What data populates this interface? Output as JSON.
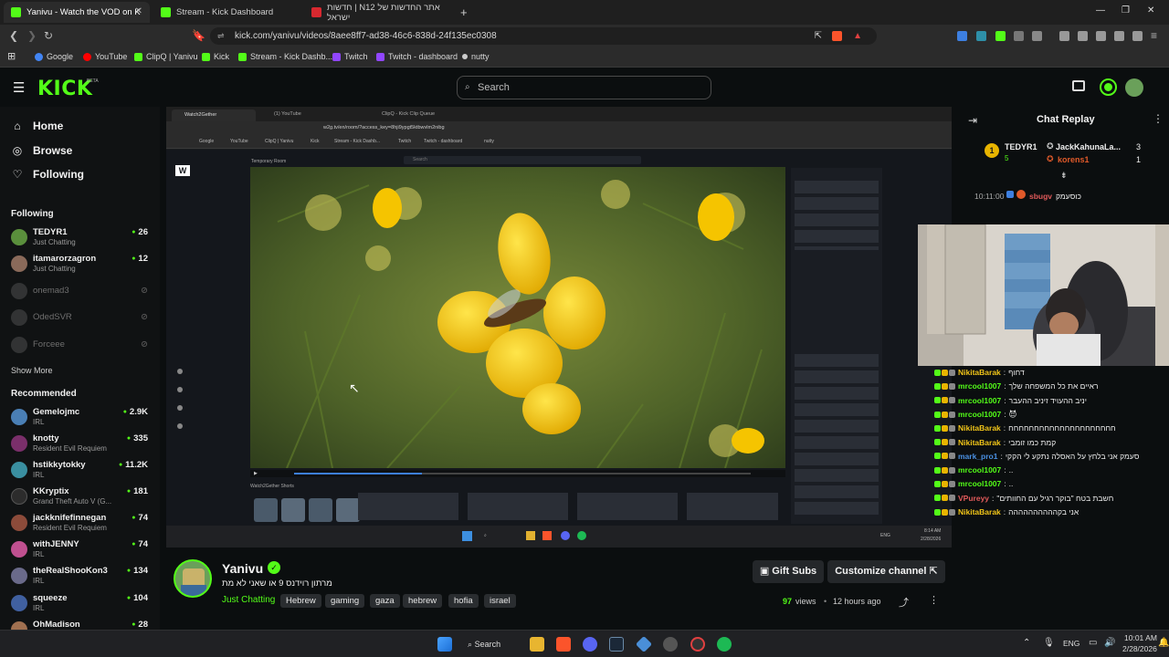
{
  "browser": {
    "tabs": [
      {
        "label": "Yanivu - Watch the VOD on K",
        "favicon_color": "#53fc18",
        "active": true
      },
      {
        "label": "Stream - Kick Dashboard",
        "favicon_color": "#53fc18",
        "active": false
      },
      {
        "label": "חדשות | N12 אתר החדשות של ישראל",
        "favicon_color": "#d7282f",
        "active": false
      }
    ],
    "new_tab": "+",
    "url": "kick.com/yanivu/videos/8aee8ff7-ad38-46c6-838d-24f135ec0308",
    "bookmarks": [
      {
        "label": "Google",
        "color": "#4285f4"
      },
      {
        "label": "YouTube",
        "color": "#ff0000"
      },
      {
        "label": "ClipQ | Yanivu",
        "color": "#53fc18"
      },
      {
        "label": "Kick",
        "color": "#53fc18"
      },
      {
        "label": "Stream - Kick Dashb...",
        "color": "#53fc18"
      },
      {
        "label": "Twitch",
        "color": "#9146ff"
      },
      {
        "label": "Twitch - dashboard",
        "color": "#9146ff"
      },
      {
        "label": "nutty",
        "color": "#cccccc"
      }
    ]
  },
  "kick": {
    "logo": "KICK",
    "logo_badge": "BETA",
    "search_placeholder": "Search",
    "accent": "#53fc18"
  },
  "sidebar": {
    "nav": [
      {
        "label": "Home",
        "icon": "home-icon"
      },
      {
        "label": "Browse",
        "icon": "compass-icon"
      },
      {
        "label": "Following",
        "icon": "heart-icon"
      }
    ],
    "following_title": "Following",
    "following": [
      {
        "name": "TEDYR1",
        "category": "Just Chatting",
        "viewers": "26",
        "live": true,
        "color": "#5a8f3c"
      },
      {
        "name": "itamarorzagron",
        "category": "Just Chatting",
        "viewers": "12",
        "live": true,
        "color": "#8a6a5a"
      },
      {
        "name": "onemad3",
        "category": "",
        "viewers": "",
        "live": false,
        "color": "#555555"
      },
      {
        "name": "OdedSVR",
        "category": "",
        "viewers": "",
        "live": false,
        "color": "#555555"
      },
      {
        "name": "Forceee",
        "category": "",
        "viewers": "",
        "live": false,
        "color": "#555555"
      }
    ],
    "show_more": "Show More",
    "recommended_title": "Recommended",
    "recommended": [
      {
        "name": "Gemelojmc",
        "category": "IRL",
        "viewers": "2.9K",
        "color": "#4a7fb5"
      },
      {
        "name": "knotty",
        "category": "Resident Evil Requiem",
        "viewers": "335",
        "color": "#7a2f6a"
      },
      {
        "name": "hstikkytokky",
        "category": "IRL",
        "viewers": "11.2K",
        "color": "#3a8fa0"
      },
      {
        "name": "KKryptix",
        "category": "Grand Theft Auto V (G...",
        "viewers": "181",
        "color": "#2c2c2c"
      },
      {
        "name": "jackknifefinnegan",
        "category": "Resident Evil Requiem",
        "viewers": "74",
        "color": "#8c4b3a"
      },
      {
        "name": "withJENNY",
        "category": "IRL",
        "viewers": "74",
        "color": "#c05090"
      },
      {
        "name": "theRealShooKon3",
        "category": "IRL",
        "viewers": "134",
        "color": "#6a6a8a"
      },
      {
        "name": "squeeze",
        "category": "IRL",
        "viewers": "104",
        "color": "#4060a0"
      },
      {
        "name": "OhMadison",
        "category": "",
        "viewers": "28",
        "color": "#a07050"
      }
    ]
  },
  "chat": {
    "title": "Chat Replay",
    "leaderboard": [
      {
        "rank": "1",
        "user": "TEDYR1",
        "count": "5",
        "user2": "JackKahunaLa...",
        "count2": "3",
        "user3": "korens1",
        "count3": "1"
      }
    ],
    "first_msg": {
      "time": "10:11:00",
      "user": "sbugv",
      "text": "כוסעמק",
      "user_color": "#e05a5a"
    },
    "messages": [
      {
        "user": "NikitaBarak",
        "text": "דחוף",
        "color": "#f0c419"
      },
      {
        "user": "mrcool1007",
        "text": "ראיים את כל המשפחה שלך",
        "color": "#53fc18"
      },
      {
        "user": "mrcool1007",
        "text": "יניב ההעויד זיניב ההעבר",
        "color": "#53fc18"
      },
      {
        "user": "mrcool1007",
        "text": "😈",
        "color": "#53fc18"
      },
      {
        "user": "NikitaBarak",
        "text": "חחחחחחחחחחחחחחחחחחחחח",
        "color": "#f0c419"
      },
      {
        "user": "NikitaBarak",
        "text": "קמת כמו זומבי",
        "color": "#f0c419"
      },
      {
        "user": "mark_pro1",
        "text": "סעמק אני בלחץ על האסלה נתקע לי הקקי",
        "color": "#4a90e2"
      },
      {
        "user": "mrcool1007",
        "text": "..",
        "color": "#53fc18"
      },
      {
        "user": "mrcool1007",
        "text": "..",
        "color": "#53fc18"
      },
      {
        "user": "VPureyy",
        "text": "\"חשבת בטח \"בוקר רגיל עם החוותים",
        "color": "#e05a5a"
      },
      {
        "user": "NikitaBarak",
        "text": "אני בקהההההההההה",
        "color": "#f0c419"
      }
    ]
  },
  "video": {
    "inner_tabs": [
      "Watch2Gether",
      "(1) YouTube",
      "ClipQ - Kick Clip Queue"
    ],
    "inner_url": "w2g.tv/en/room/?access_key=8hji9ypgt5ktbwvlm2nibg",
    "inner_room": "Temporary Room",
    "inner_time": "8:14 AM",
    "inner_date": "2/28/2026",
    "inner_lang": "ENG",
    "inner_shorts": "Watch2Gether Shorts",
    "inner_logo": "W",
    "inner_search": "Search",
    "inner_bookmarks": [
      "Google",
      "YouTube",
      "ClipQ | Yanivu",
      "Kick",
      "Stream - Kick Dashb...",
      "Twitch",
      "Twitch - dashboard",
      "nutty"
    ],
    "progress_fraction": 0.28
  },
  "channel": {
    "name": "Yanivu",
    "title": "מרתון רוידנס 9 או שאני לא מת",
    "category": "Just Chatting",
    "tags": [
      "Hebrew",
      "gaming",
      "gaza",
      "hebrew",
      "hofia",
      "israel"
    ],
    "views": "97",
    "views_label": "views",
    "time_ago": "12 hours ago",
    "gift_subs": "Gift Subs",
    "customize": "Customize channel"
  },
  "taskbar": {
    "search": "Search",
    "lang": "ENG",
    "time": "10:01 AM",
    "date": "2/28/2026"
  }
}
